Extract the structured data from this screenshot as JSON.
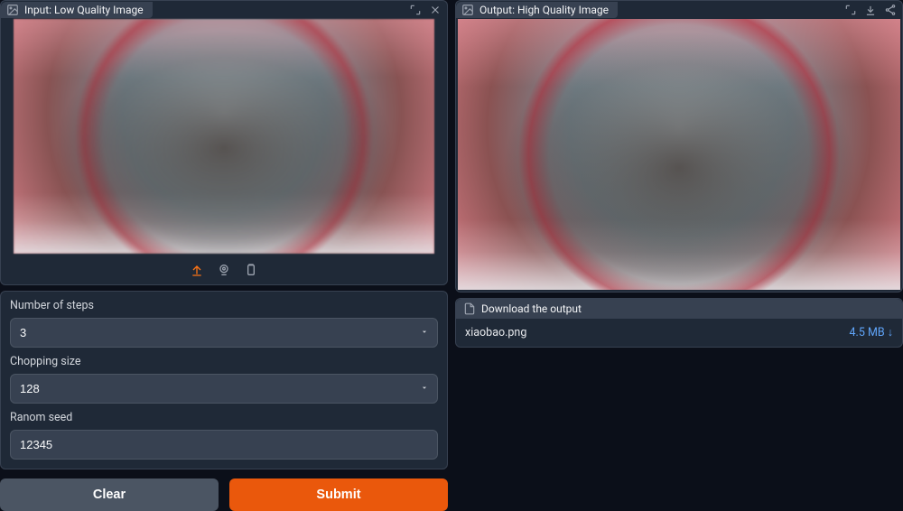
{
  "input": {
    "panel_title": "Input: Low Quality Image",
    "fields": {
      "steps_label": "Number of steps",
      "steps_value": "3",
      "chopping_label": "Chopping size",
      "chopping_value": "128",
      "seed_label": "Ranom seed",
      "seed_value": "12345"
    },
    "buttons": {
      "clear": "Clear",
      "submit": "Submit"
    },
    "icons": {
      "image": "image-icon",
      "expand": "expand-icon",
      "close": "close-icon",
      "upload": "upload-icon",
      "webcam": "webcam-icon",
      "clipboard": "clipboard-icon"
    }
  },
  "output": {
    "panel_title": "Output: High Quality Image",
    "download_title": "Download the output",
    "file": {
      "name": "xiaobao.png",
      "size": "4.5 MB ↓"
    },
    "icons": {
      "image": "image-icon",
      "expand": "expand-icon",
      "download": "download-icon",
      "share": "share-icon",
      "file": "file-icon"
    }
  }
}
